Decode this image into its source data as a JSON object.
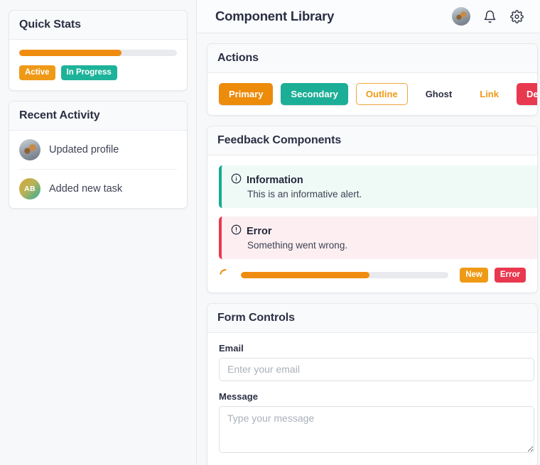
{
  "header": {
    "title": "Component Library",
    "avatar_icon": "user-avatar-photo",
    "bell_icon": "bell-icon",
    "gear_icon": "gear-icon"
  },
  "sidebar": {
    "quick_stats": {
      "title": "Quick Stats",
      "progress_percent": 65,
      "badges": [
        {
          "label": "Active",
          "color": "#ef9a16"
        },
        {
          "label": "In Progress",
          "color": "#1db39a"
        }
      ]
    },
    "recent_activity": {
      "title": "Recent Activity",
      "items": [
        {
          "label": "Updated profile",
          "avatar_type": "photo",
          "initials": ""
        },
        {
          "label": "Added new task",
          "avatar_type": "initials",
          "initials": "AB"
        }
      ]
    }
  },
  "main": {
    "actions": {
      "title": "Actions",
      "buttons": [
        {
          "label": "Primary",
          "variant": "primary"
        },
        {
          "label": "Secondary",
          "variant": "secondary"
        },
        {
          "label": "Outline",
          "variant": "outline"
        },
        {
          "label": "Ghost",
          "variant": "ghost"
        },
        {
          "label": "Link",
          "variant": "link"
        },
        {
          "label": "Delete",
          "variant": "danger"
        }
      ]
    },
    "feedback": {
      "title": "Feedback Components",
      "alerts": [
        {
          "variant": "info",
          "icon": "info-circle-icon",
          "title": "Information",
          "description": "This is an informative alert.",
          "accent": "#14ab93"
        },
        {
          "variant": "error",
          "icon": "alert-circle-icon",
          "title": "Error",
          "description": "Something went wrong.",
          "accent": "#e8394f"
        }
      ],
      "spinner": {
        "icon": "loading-spinner-icon",
        "color": "#ef8c10"
      },
      "progress_percent": 62,
      "badges": [
        {
          "label": "New",
          "color": "#ef9a16"
        },
        {
          "label": "Error",
          "color": "#e8384f"
        }
      ]
    },
    "form": {
      "title": "Form Controls",
      "email": {
        "label": "Email",
        "value": "",
        "placeholder": "Enter your email"
      },
      "message": {
        "label": "Message",
        "value": "",
        "placeholder": "Type your message"
      }
    }
  }
}
